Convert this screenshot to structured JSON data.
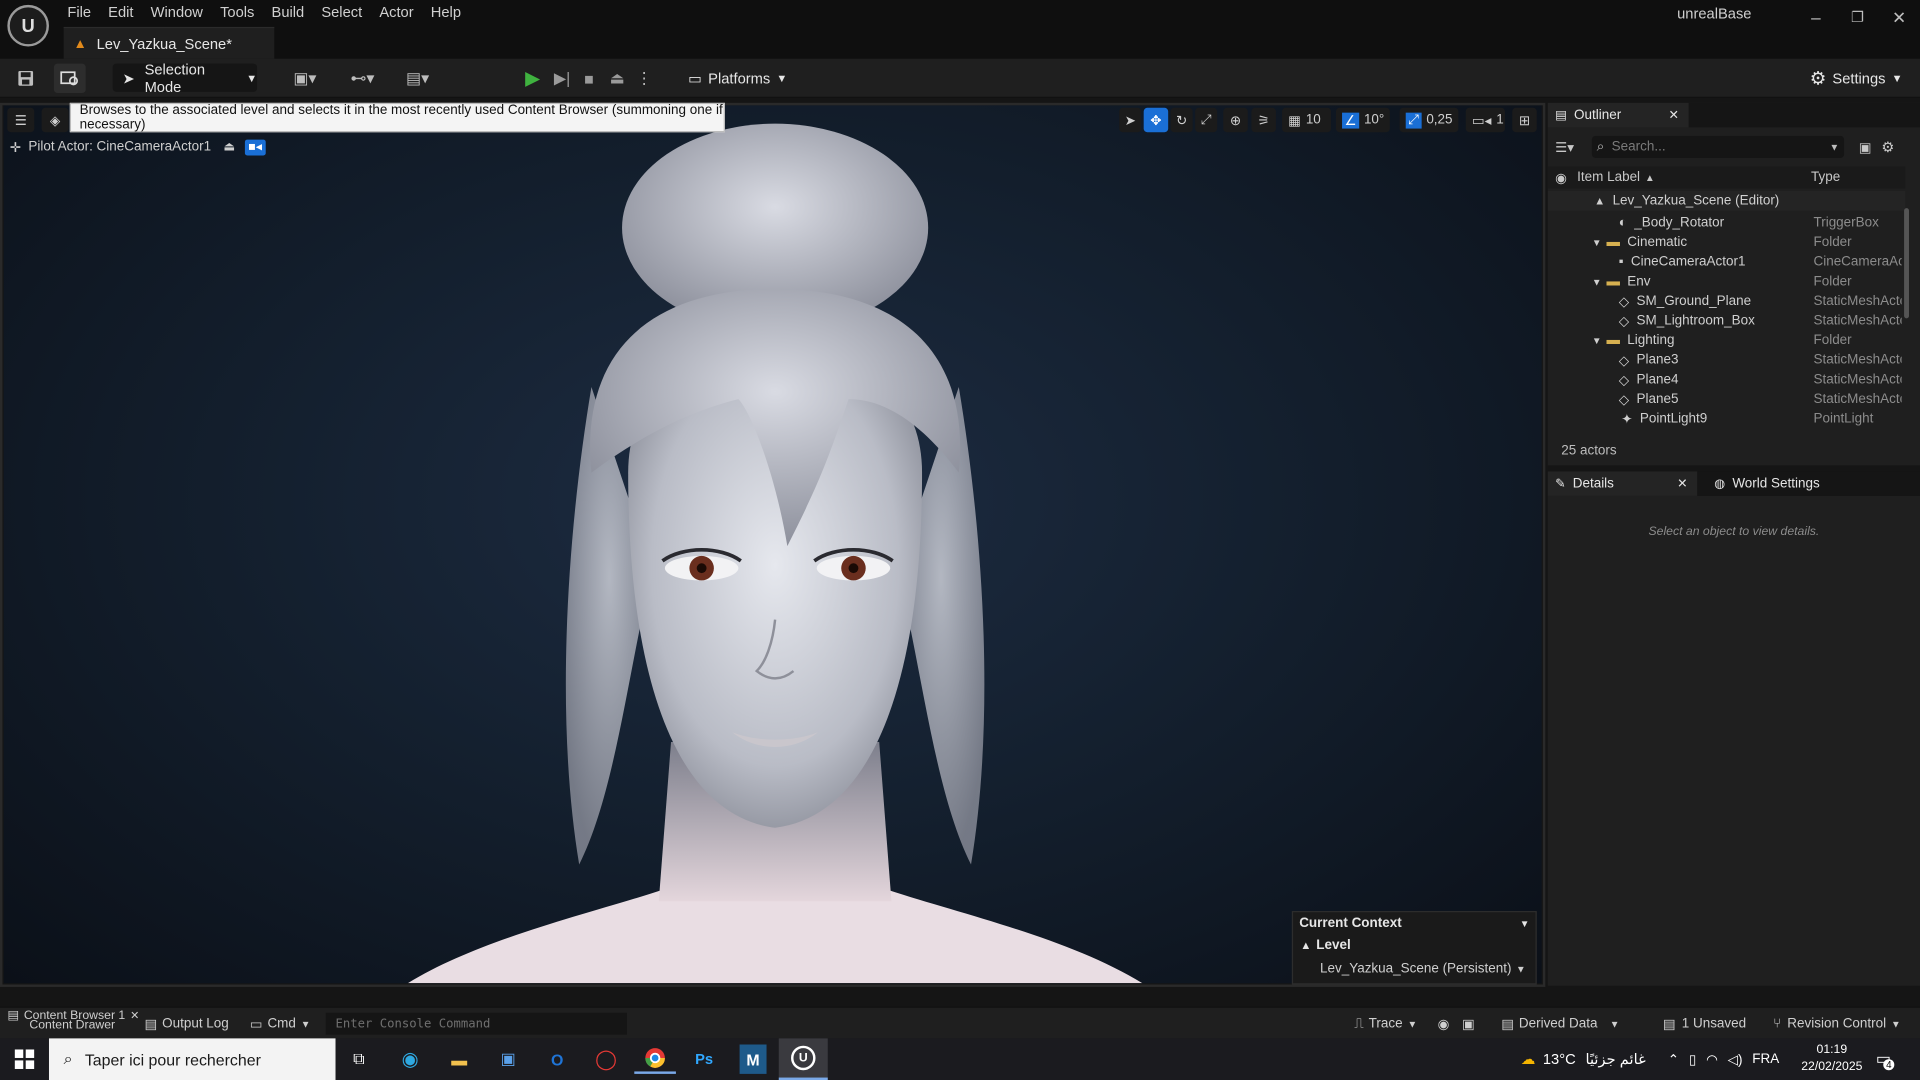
{
  "app": {
    "logo_text": "U",
    "menus": [
      "File",
      "Edit",
      "Window",
      "Tools",
      "Build",
      "Select",
      "Actor",
      "Help"
    ],
    "document_tab": "Lev_Yazkua_Scene*",
    "project_name": "unrealBase",
    "window_controls": {
      "minimize": "–",
      "restore": "❐",
      "close": "✕"
    }
  },
  "toolbar": {
    "selection_mode": "Selection Mode",
    "platforms": "Platforms",
    "settings": "Settings"
  },
  "viewport": {
    "tooltip": "Browses to the associated level and selects it in the most recently used Content Browser (summoning one if necessary)",
    "pilot_actor": "Pilot Actor: CineCameraActor1",
    "grid_snap": "10",
    "rotation_snap": "10°",
    "scale_snap": "0,25",
    "camera_speed": "1"
  },
  "context": {
    "title": "Current Context",
    "level_label": "Level",
    "level_value": "Lev_Yazkua_Scene (Persistent)"
  },
  "outliner": {
    "tab": "Outliner",
    "search_placeholder": "Search...",
    "col_label": "Item Label",
    "col_type": "Type",
    "rows": [
      {
        "label": "Lev_Yazkua_Scene (Editor)",
        "type": ""
      },
      {
        "label": "_Body_Rotator",
        "type": "TriggerBox"
      },
      {
        "label": "Cinematic",
        "type": "Folder"
      },
      {
        "label": "CineCameraActor1",
        "type": "CineCameraAc"
      },
      {
        "label": "Env",
        "type": "Folder"
      },
      {
        "label": "SM_Ground_Plane",
        "type": "StaticMeshActo"
      },
      {
        "label": "SM_Lightroom_Box",
        "type": "StaticMeshActo"
      },
      {
        "label": "Lighting",
        "type": "Folder"
      },
      {
        "label": "Plane3",
        "type": "StaticMeshActo"
      },
      {
        "label": "Plane4",
        "type": "StaticMeshActo"
      },
      {
        "label": "Plane5",
        "type": "StaticMeshActo"
      },
      {
        "label": "PointLight9",
        "type": "PointLight"
      }
    ],
    "actor_count": "25 actors"
  },
  "details": {
    "tab": "Details",
    "world_settings_tab": "World Settings",
    "empty_message": "Select an object to view details."
  },
  "bottombar": {
    "content_browser": "Content Browser 1",
    "content_drawer": "Content Drawer",
    "output_log": "Output Log",
    "cmd": "Cmd",
    "console_placeholder": "Enter Console Command",
    "trace": "Trace",
    "derived_data": "Derived Data",
    "unsaved": "1 Unsaved",
    "revision_control": "Revision Control"
  },
  "taskbar": {
    "search_placeholder": "Taper ici pour rechercher",
    "weather_temp": "13°C",
    "weather_text": "غائم جزئيًا",
    "language": "FRA",
    "time": "01:19",
    "date": "22/02/2025",
    "notification_count": "4"
  },
  "colors": {
    "accent_blue": "#1a6fd6",
    "play_green": "#3fb23f",
    "warning_orange": "#e28a1b",
    "panel_bg": "#1f1f1f",
    "viewport_bg": "#14202f"
  }
}
